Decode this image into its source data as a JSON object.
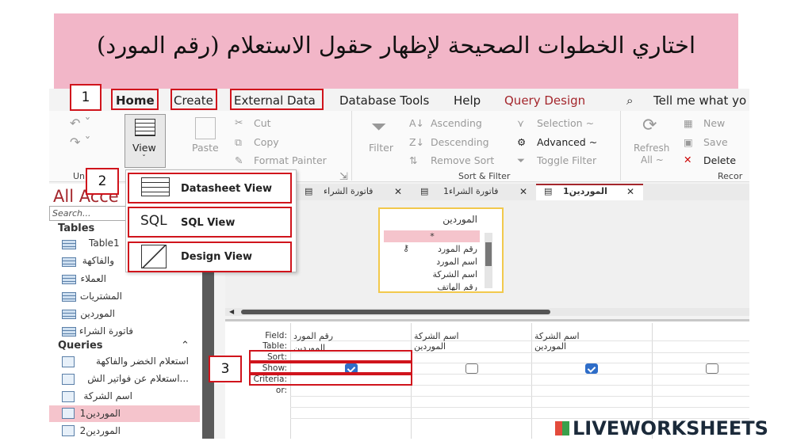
{
  "banner": {
    "text": "اختاري الخطوات الصحيحة لإظهار حقول  الاستعلام (رقم المورد)"
  },
  "tabs": [
    "Home",
    "Create",
    "External Data",
    "Database Tools",
    "Help",
    "Query Design"
  ],
  "tell_me": "Tell me what yo",
  "callouts": {
    "one": "1",
    "two": "2",
    "three": "3"
  },
  "ribbon": {
    "view": "View",
    "paste": "Paste",
    "cut": "Cut",
    "copy": "Copy",
    "format_painter": "Format Painter",
    "filter": "Filter",
    "ascending": "Ascending",
    "descending": "Descending",
    "remove_sort": "Remove Sort",
    "selection": "Selection ~",
    "advanced": "Advanced ~",
    "toggle_filter": "Toggle Filter",
    "refresh": "Refresh",
    "all": "All ~",
    "new": "New",
    "save": "Save",
    "delete": "Delete",
    "group_undo": "Un",
    "group_sort": "Sort & Filter",
    "group_records": "Recor"
  },
  "view_menu": {
    "datasheet": "Datasheet View",
    "sql_icon": "SQL",
    "sql": "SQL View",
    "design": "Design View"
  },
  "nav": {
    "title": "All Acce",
    "search": "Search...",
    "tables_header": "Tables",
    "queries_header": "Queries",
    "tables": [
      "Table1",
      "والفاكهة",
      "العملاء",
      "المشتريات",
      "الموردين",
      "فاتورة الشراء"
    ],
    "queries": [
      "استعلام الخضر والفاكهة",
      "...استعلام عن فواتير الش",
      "اسم الشركة",
      "الموردين1",
      "الموردين2"
    ]
  },
  "doc_tabs": [
    "فاتورة الشراء",
    "فاتورة الشراء1",
    "الموردين1"
  ],
  "table_box": {
    "title": "الموردين",
    "fields": [
      "*",
      "رقم المورد",
      "اسم المورد",
      "اسم الشركة",
      "رقم الهاتف"
    ]
  },
  "grid": {
    "labels": [
      "Field:",
      "Table:",
      "Sort:",
      "Show:",
      "Criteria:",
      "or:"
    ],
    "columns": [
      {
        "field": "رقم المورد",
        "table": "الموردين",
        "show": true
      },
      {
        "field": "اسم الشركة",
        "table": "الموردين",
        "show": false
      },
      {
        "field": "اسم الشركة",
        "table": "الموردين",
        "show": true
      },
      {
        "field": "",
        "table": "",
        "show": false
      }
    ]
  },
  "logo": "LIVEWORKSHEETS"
}
